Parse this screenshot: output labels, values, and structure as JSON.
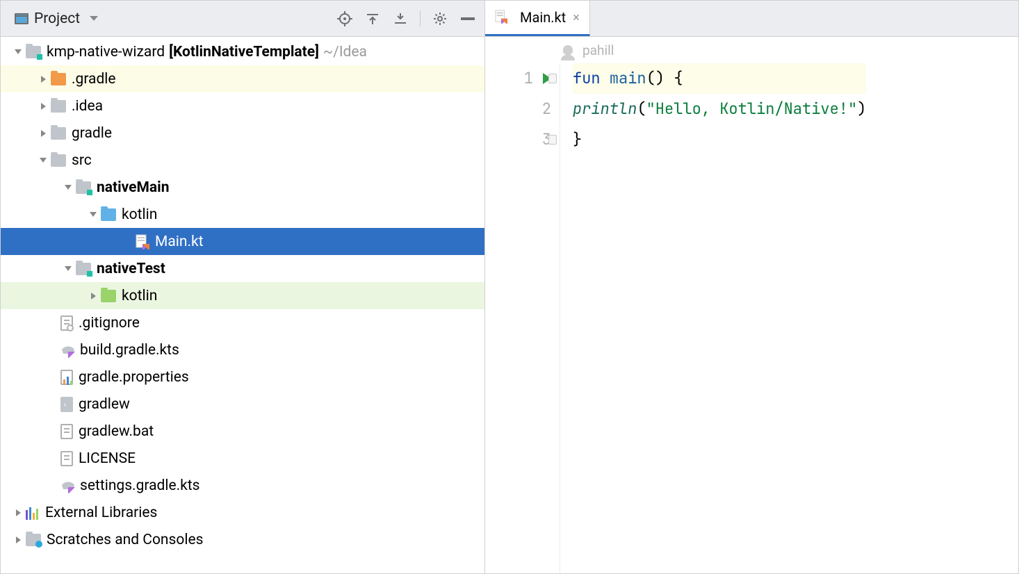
{
  "project_panel": {
    "title": "Project",
    "root": {
      "name": "kmp-native-wizard",
      "module": "[KotlinNativeTemplate]",
      "path_hint": "~/Idea"
    },
    "items": {
      "gradle_dot": ".gradle",
      "idea": ".idea",
      "gradle": "gradle",
      "src": "src",
      "nativeMain": "nativeMain",
      "kotlin1": "kotlin",
      "mainkt": "Main.kt",
      "nativeTest": "nativeTest",
      "kotlin2": "kotlin",
      "gitignore": ".gitignore",
      "buildgradle": "build.gradle.kts",
      "gradleprops": "gradle.properties",
      "gradlew": "gradlew",
      "gradlewbat": "gradlew.bat",
      "license": "LICENSE",
      "settings": "settings.gradle.kts",
      "external": "External Libraries",
      "scratches": "Scratches and Consoles"
    }
  },
  "editor": {
    "tab_label": "Main.kt",
    "author": "pahill",
    "lines": {
      "l1_kw": "fun",
      "l1_fn": "main",
      "l1_rest": "() {",
      "l2_fn": "println",
      "l2_open": "(",
      "l2_str": "\"Hello, Kotlin/Native!\"",
      "l2_close": ")",
      "l3": "}"
    },
    "numbers": [
      "1",
      "2",
      "3"
    ]
  }
}
